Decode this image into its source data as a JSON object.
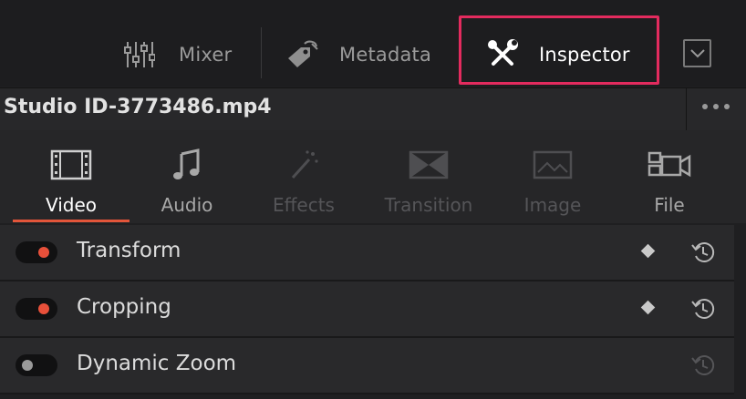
{
  "toolbar": {
    "mixer_label": "Mixer",
    "metadata_label": "Metadata",
    "inspector_label": "Inspector",
    "collapse_icon": "chevron-down-icon"
  },
  "clip": {
    "title": "Studio ID-3773486.mp4",
    "more_icon": "more-horizontal-icon"
  },
  "tabs": [
    {
      "label": "Video",
      "icon": "film-icon",
      "state": "active"
    },
    {
      "label": "Audio",
      "icon": "music-note-icon",
      "state": "enabled"
    },
    {
      "label": "Effects",
      "icon": "magic-wand-icon",
      "state": "disabled"
    },
    {
      "label": "Transition",
      "icon": "transition-icon",
      "state": "disabled"
    },
    {
      "label": "Image",
      "icon": "image-icon",
      "state": "disabled"
    },
    {
      "label": "File",
      "icon": "camera-file-icon",
      "state": "enabled"
    }
  ],
  "sections": [
    {
      "label": "Transform",
      "enabled": true
    },
    {
      "label": "Cropping",
      "enabled": true
    },
    {
      "label": "Dynamic Zoom",
      "enabled": false
    }
  ],
  "colors": {
    "accent": "#e8503a",
    "highlight_box": "#e32b5e",
    "background": "#1f1f21"
  }
}
